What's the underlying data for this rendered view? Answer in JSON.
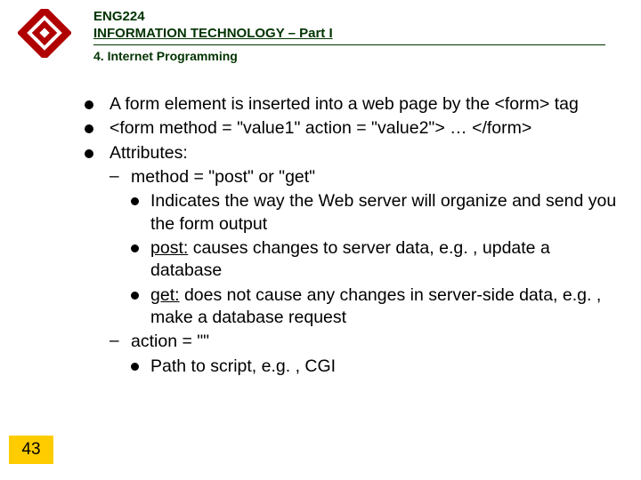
{
  "header": {
    "course_code": "ENG224",
    "course_title": "INFORMATION TECHNOLOGY – Part I",
    "subtitle": "4. Internet Programming"
  },
  "bullets": [
    {
      "text": "A form element is inserted into a web page by the <form> tag"
    },
    {
      "text": "<form method = \"value1\" action = \"value2\"> … </form>"
    },
    {
      "text": "Attributes:",
      "children": [
        {
          "text": "method = \"post\" or \"get\"",
          "children": [
            {
              "text": "Indicates the way the Web server will organize and send you the form output"
            },
            {
              "prefix_u": "post:",
              "rest": " causes changes to server data, e.g. , update a database"
            },
            {
              "prefix_u": "get:",
              "rest": " does not cause any changes in server-side data, e.g. , make a database request"
            }
          ]
        },
        {
          "text": "action = \"\"",
          "children": [
            {
              "text": "Path to script, e.g. , CGI"
            }
          ]
        }
      ]
    }
  ],
  "slide_number": "43"
}
